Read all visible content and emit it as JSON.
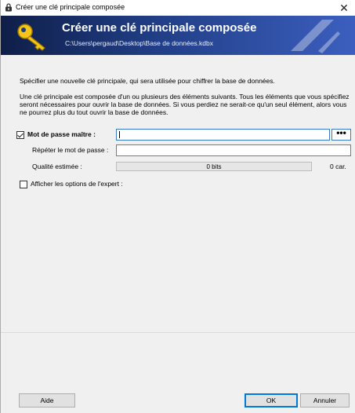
{
  "window": {
    "title": "Créer une clé principale composée",
    "close_glyph": "✕"
  },
  "banner": {
    "title": "Créer une clé principale composée",
    "path": "C:\\Users\\pergaud\\Desktop\\Base de données.kdbx"
  },
  "intro": {
    "line1": "Spécifier une nouvelle clé principale, qui sera utilisée pour chiffrer la base de données.",
    "line2": "Une clé principale est composée d'un ou plusieurs des éléments suivants. Tous les éléments que vous spécifiez seront nécessaires pour ouvrir la base de données. Si vous perdiez ne serait-ce qu'un seul élément, alors vous ne pourrez plus du tout ouvrir la base de données."
  },
  "password": {
    "label": "Mot de passe maître :",
    "checked": true,
    "value": "",
    "toggle_label": "•••",
    "repeat_label": "Répéter le mot de passe :",
    "repeat_value": "",
    "quality_label": "Qualité estimée :",
    "quality_bits": "0 bits",
    "quality_chars": "0 car.",
    "quality_fill": 0
  },
  "expert": {
    "label": "Afficher les options de l'expert :",
    "checked": false
  },
  "footer": {
    "help": "Aide",
    "ok": "OK",
    "cancel": "Annuler"
  },
  "colors": {
    "banner_start": "#0f1e48",
    "banner_end": "#3c5fbf",
    "focus": "#3b79c9",
    "default_button": "#0078d7"
  },
  "icons": [
    "lock-icon",
    "key-icon",
    "close-icon",
    "checkbox-checked-icon",
    "checkbox-unchecked-icon"
  ]
}
